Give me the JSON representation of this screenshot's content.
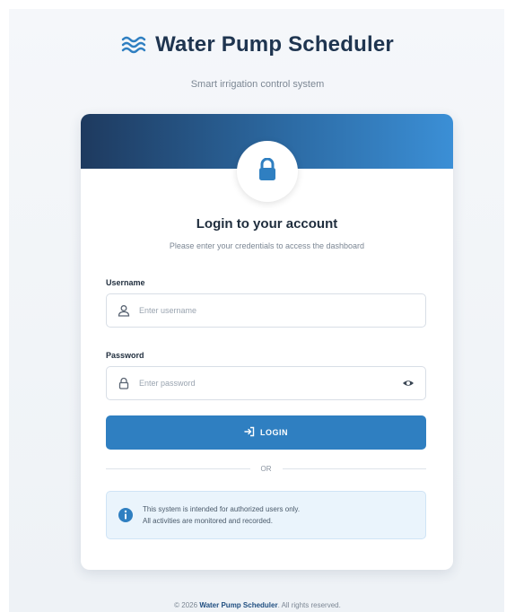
{
  "brand": {
    "icon": "water-waves-icon",
    "title": "Water Pump Scheduler",
    "subtitle": "Smart irrigation control system"
  },
  "card": {
    "header_icon": "lock-icon",
    "title": "Login to your account",
    "subtitle": "Please enter your credentials to access the dashboard",
    "username": {
      "label": "Username",
      "placeholder": "Enter username",
      "value": "",
      "icon": "user-icon"
    },
    "password": {
      "label": "Password",
      "placeholder": "Enter password",
      "value": "",
      "icon": "lock-small-icon",
      "toggle_icon": "eye-icon"
    },
    "login_button": {
      "label": "LOGIN",
      "icon": "sign-in-icon"
    },
    "divider_text": "OR",
    "notice": {
      "icon": "info-icon",
      "line1": "This system is intended for authorized users only.",
      "line2": "All activities are monitored and recorded."
    }
  },
  "footer": {
    "prefix": "© 2026",
    "brand": "Water Pump Scheduler",
    "suffix": ". All rights reserved."
  },
  "colors": {
    "primary": "#2f7fc1",
    "header_dark": "#1e3a5f",
    "title_text": "#1f3550",
    "notice_bg": "#eaf4fc"
  }
}
